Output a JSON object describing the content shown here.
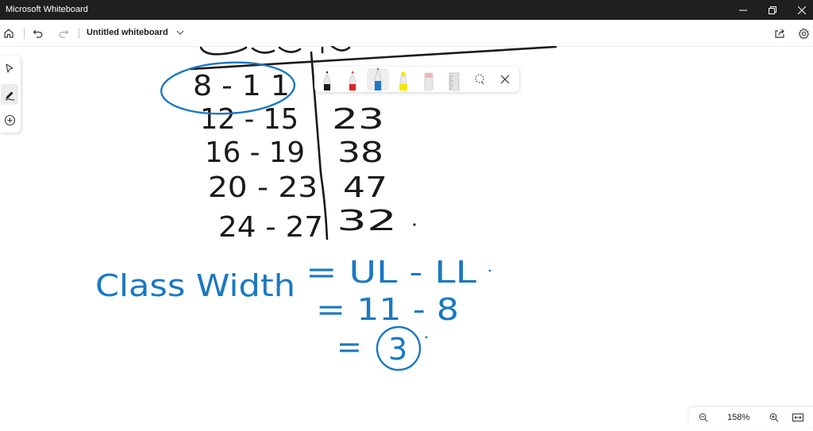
{
  "window": {
    "app_title": "Microsoft Whiteboard",
    "minimize_icon": "minimize-icon",
    "restore_icon": "restore-icon",
    "close_icon": "close-icon"
  },
  "appbar": {
    "document_title": "Untitled whiteboard",
    "home_icon": "home-icon",
    "undo_icon": "undo-icon",
    "redo_icon": "redo-icon",
    "share_icon": "share-icon",
    "settings_icon": "gear-icon"
  },
  "left_rail": {
    "items": [
      {
        "name": "select",
        "icon": "select-arrow-icon",
        "active": false
      },
      {
        "name": "inking",
        "icon": "pen-icon",
        "active": true
      },
      {
        "name": "add",
        "icon": "plus-circle-icon",
        "active": false
      }
    ]
  },
  "ink_toolbar": {
    "tools": [
      {
        "name": "pen-black",
        "color": "#1a1a1a"
      },
      {
        "name": "pen-red",
        "color": "#e0202a"
      },
      {
        "name": "pen-blue",
        "color": "#1e78c8",
        "active": true
      },
      {
        "name": "highlighter-yellow",
        "color": "#f4e600"
      },
      {
        "name": "eraser",
        "color": "#f2b6b6"
      },
      {
        "name": "ruler",
        "color": "#d0d0d0"
      },
      {
        "name": "lasso",
        "color": "#555555"
      }
    ],
    "close_icon": "close-icon"
  },
  "board": {
    "ink_colors": {
      "black": "#1a1a1a",
      "blue": "#1a78c2"
    },
    "table": {
      "rows": [
        {
          "class": "8 - 1 1",
          "freq": ""
        },
        {
          "class": "12 - 15",
          "freq": "23"
        },
        {
          "class": "16 - 19",
          "freq": "38"
        },
        {
          "class": "20 - 23",
          "freq": "47"
        },
        {
          "class": "24 - 27",
          "freq": "32"
        }
      ]
    },
    "notes": {
      "line1_left": "Class Width",
      "line1_right": "= UL - LL",
      "line2": "= 11 - 8",
      "line3_eq": "=",
      "answer": "3"
    }
  },
  "zoom": {
    "level": "158%",
    "zoom_out_icon": "zoom-out-icon",
    "zoom_in_icon": "zoom-in-icon",
    "fit_icon": "fit-to-screen-icon"
  }
}
